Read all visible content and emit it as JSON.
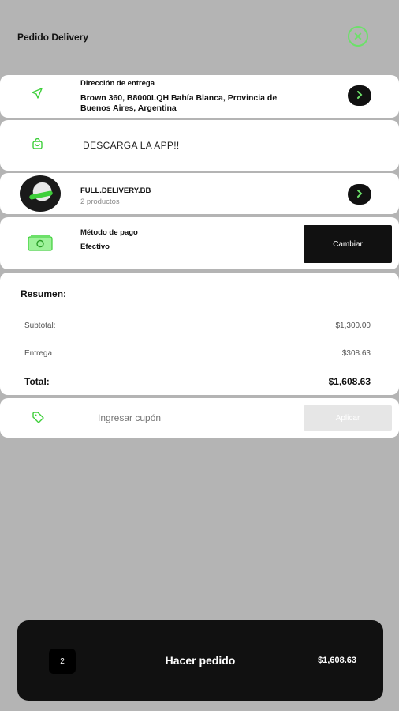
{
  "header": {
    "title": "Pedido Delivery"
  },
  "address": {
    "label": "Dirección de entrega",
    "value": "Brown 360, B8000LQH Bahía Blanca, Provincia de Buenos Aires, Argentina"
  },
  "app_promo": {
    "label": "DESCARGA LA APP!!"
  },
  "store": {
    "name": "FULL.DELIVERY.BB",
    "products": "2 productos"
  },
  "payment": {
    "label": "Método de pago",
    "value": "Efectivo",
    "change_label": "Cambiar"
  },
  "summary": {
    "title": "Resumen:",
    "subtotal_label": "Subtotal:",
    "subtotal_value": "$1,300.00",
    "delivery_label": "Entrega",
    "delivery_value": "$308.63",
    "total_label": "Total:",
    "total_value": "$1,608.63"
  },
  "coupon": {
    "placeholder": "Ingresar cupón",
    "apply_label": "Aplicar"
  },
  "order": {
    "count": "2",
    "label": "Hacer pedido",
    "total": "$1,608.63"
  },
  "colors": {
    "accent": "#3ecf3a",
    "background": "#b4b4b4",
    "dark": "#111111"
  },
  "icons": [
    "close-icon",
    "navigation-arrow-icon",
    "shopping-bag-icon",
    "chevron-right-icon",
    "cash-icon",
    "tag-icon"
  ]
}
